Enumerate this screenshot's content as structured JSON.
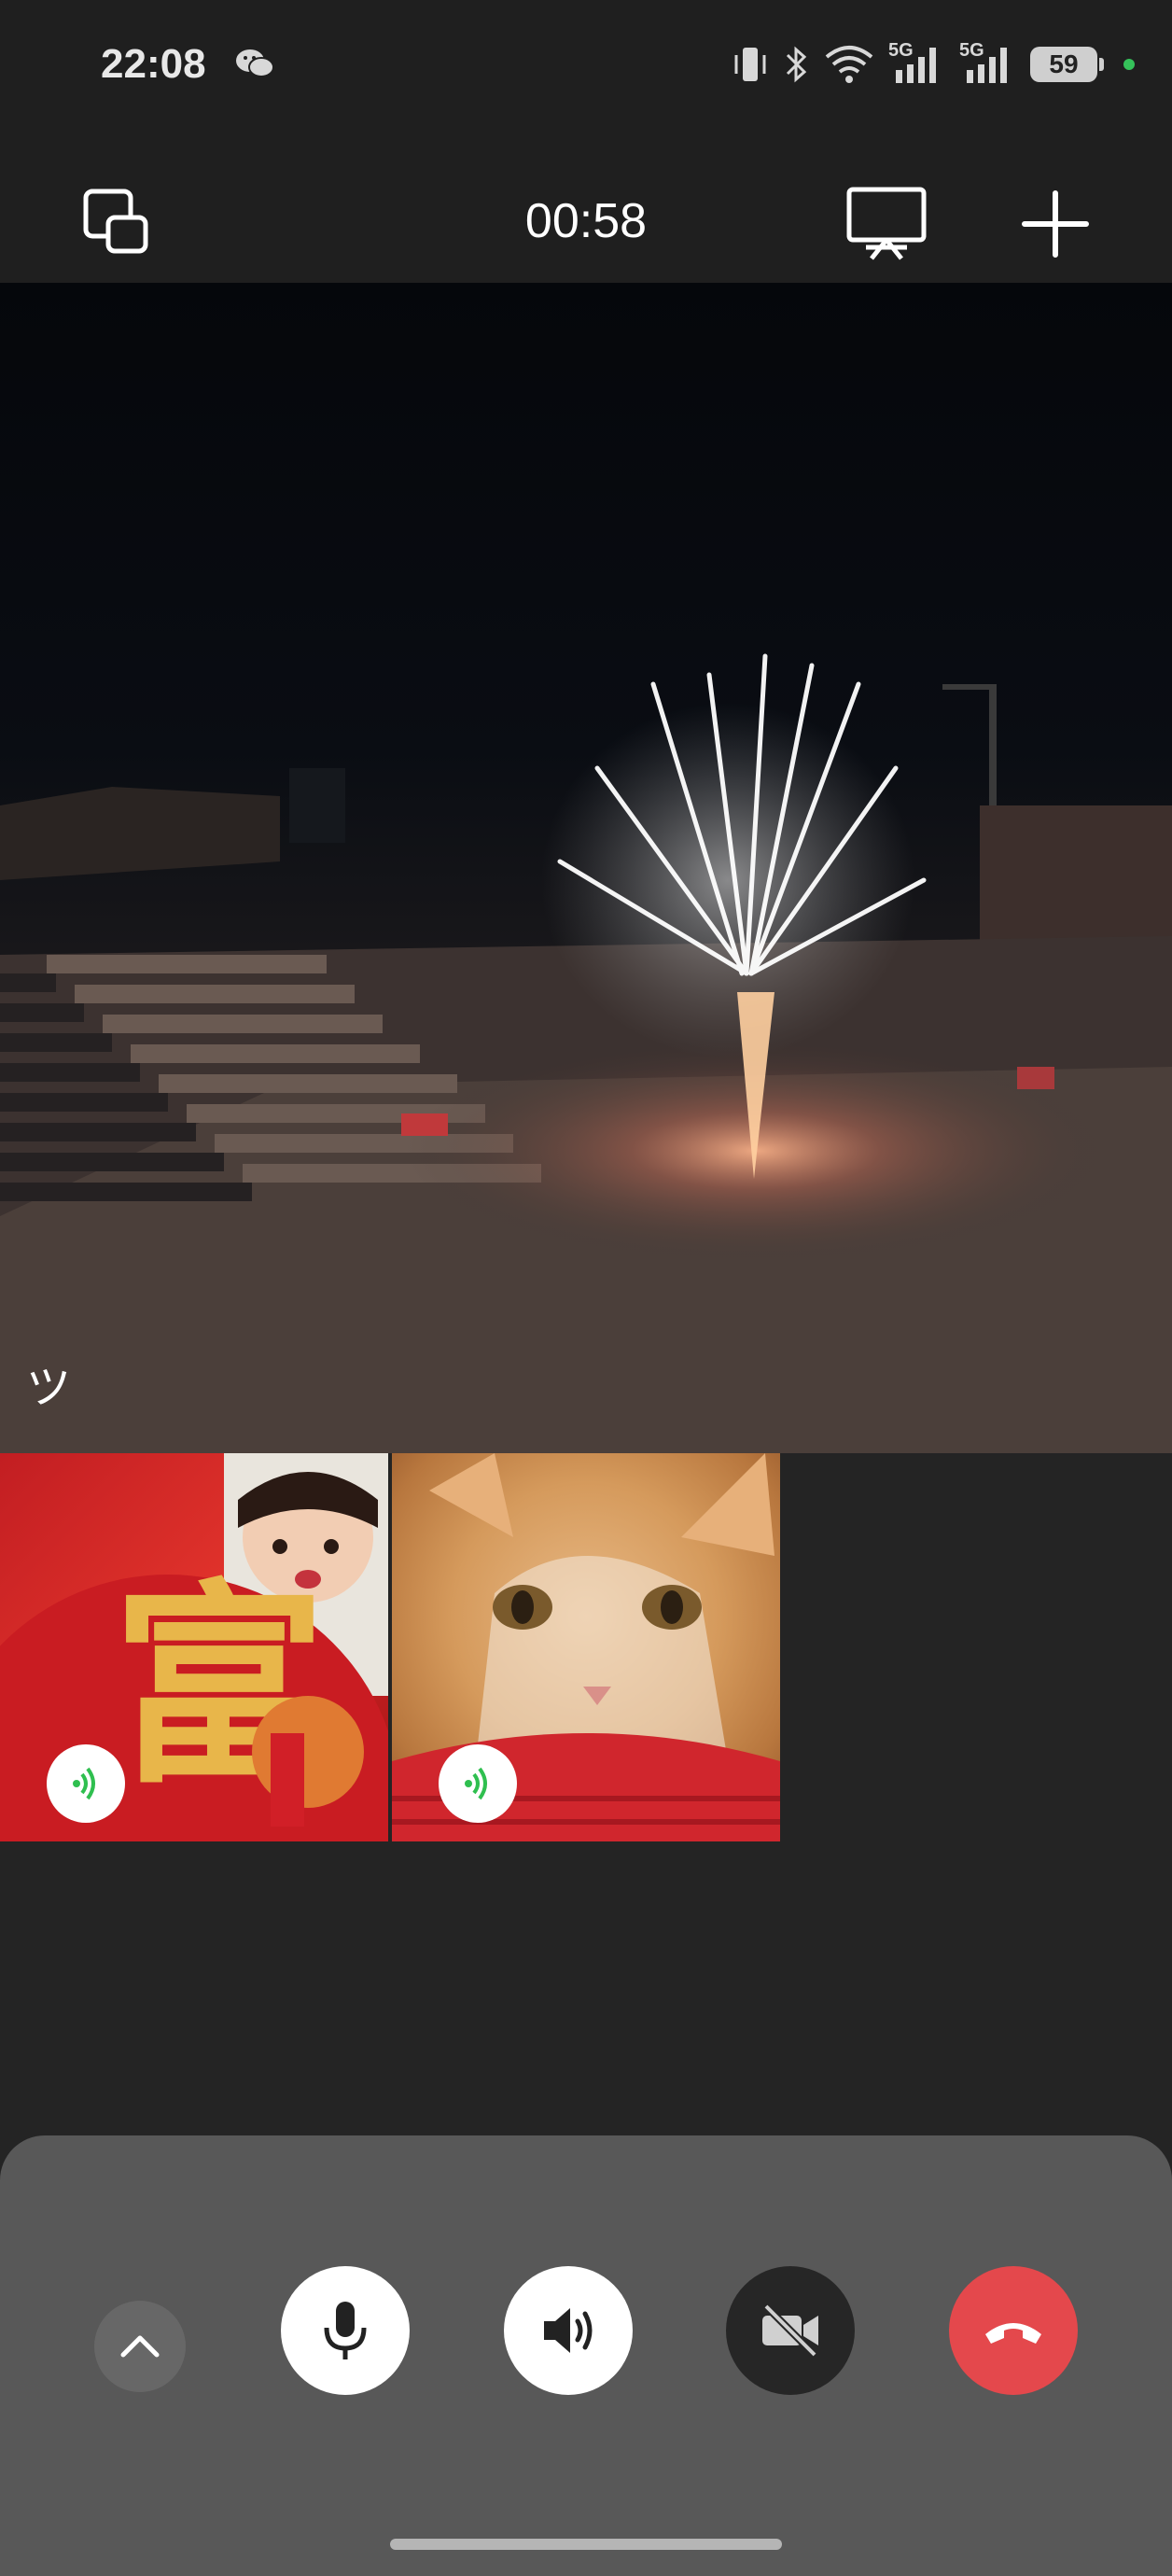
{
  "status_bar": {
    "time": "22:08",
    "network_5g_1": "5G",
    "network_5g_2": "5G",
    "battery": "59",
    "icons": [
      "wechat-icon",
      "vibrate-icon",
      "bluetooth-icon",
      "wifi-icon",
      "signal-icon",
      "signal-icon",
      "battery-icon"
    ]
  },
  "call": {
    "timer": "00:58",
    "main_participant_label": "ツ"
  },
  "colors": {
    "hangup": "#e4484c",
    "speaking_indicator": "#2fbf4f"
  }
}
